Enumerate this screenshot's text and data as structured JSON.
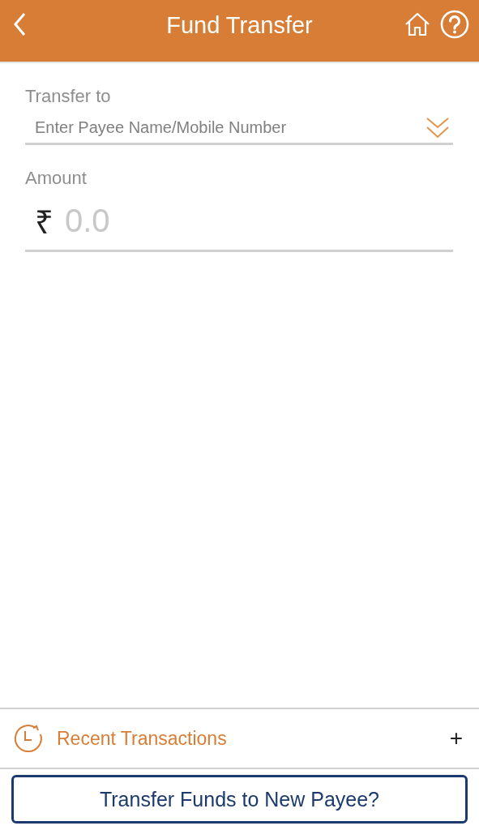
{
  "header": {
    "title": "Fund Transfer"
  },
  "transfer_to": {
    "label": "Transfer to",
    "placeholder": "Enter Payee Name/Mobile Number"
  },
  "amount": {
    "label": "Amount",
    "currency": "₹",
    "placeholder": "0.0"
  },
  "recent": {
    "label": "Recent Transactions",
    "toggle": "+"
  },
  "new_payee_button": "Transfer Funds to New Payee?"
}
